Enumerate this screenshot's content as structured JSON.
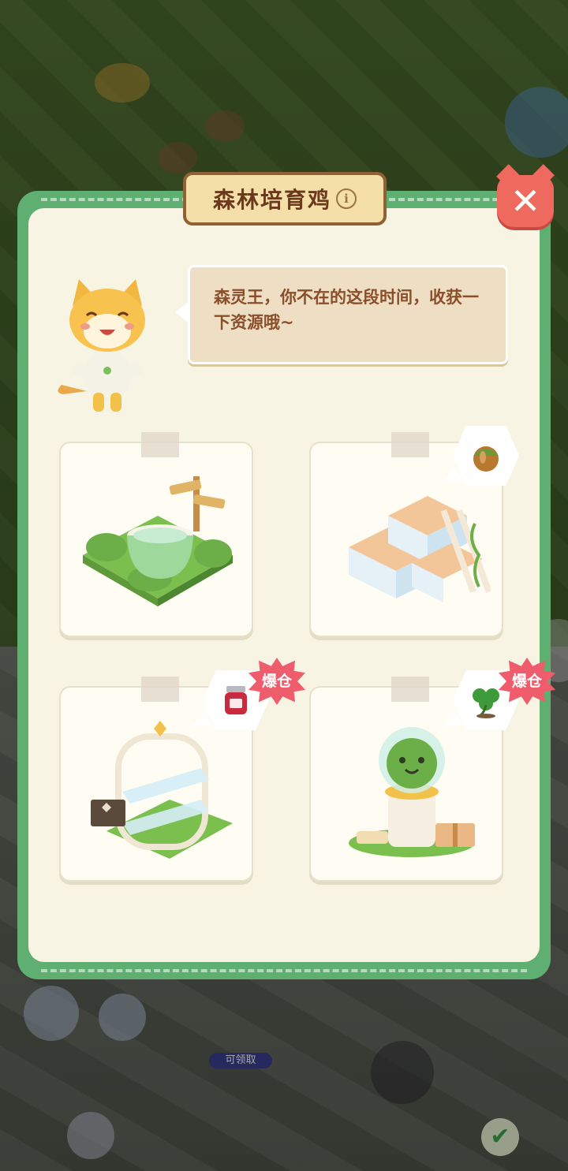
{
  "dialog": {
    "title": "森林培育鸡",
    "info_icon": "info-icon",
    "close_icon": "close-icon",
    "close_symbol": "✕",
    "info_symbol": "i"
  },
  "speech": {
    "text": "森灵王，你不在的这段时间，收获一下资源哦~"
  },
  "buildings": [
    {
      "name": "pond-garden",
      "resource_icon": null,
      "badge": null
    },
    {
      "name": "crate-stack",
      "resource_icon": "acorn-icon",
      "badge": null
    },
    {
      "name": "glass-shelf",
      "resource_icon": "jam-jar-icon",
      "badge": "爆仓"
    },
    {
      "name": "moss-statue",
      "resource_icon": "clover-icon",
      "badge": "爆仓"
    }
  ],
  "background": {
    "claim_label": "可领取",
    "check_icon": "check-icon",
    "check_symbol": "✔"
  },
  "colors": {
    "panel_border": "#5fae72",
    "panel_bg": "#f8f4e4",
    "title_text": "#6b3a1c",
    "close_button": "#ef6a5e",
    "badge": "#ef5d6c",
    "speech_text": "#8a4f2a"
  }
}
